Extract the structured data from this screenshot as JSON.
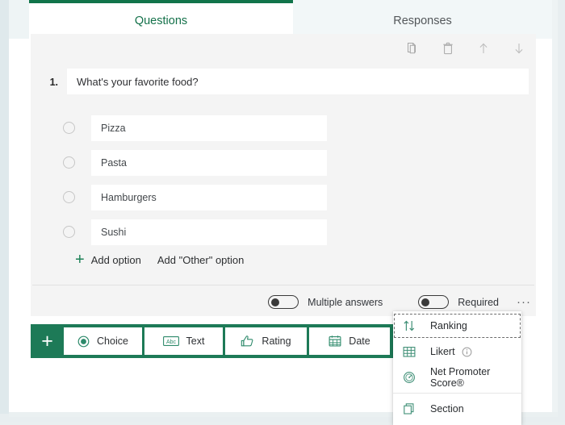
{
  "tabs": [
    {
      "label": "Questions",
      "active": true
    },
    {
      "label": "Responses",
      "active": false
    }
  ],
  "toolbar": {
    "copy_icon": "copy-icon",
    "delete_icon": "trash-icon",
    "move_up_icon": "arrow-up-icon",
    "move_down_icon": "arrow-down-icon"
  },
  "question": {
    "number": "1.",
    "title": "What's your favorite food?",
    "options": [
      {
        "label": "Pizza"
      },
      {
        "label": "Pasta"
      },
      {
        "label": "Hamburgers"
      },
      {
        "label": "Sushi"
      }
    ],
    "add_option_label": "Add option",
    "add_other_label": "Add \"Other\" option",
    "multiple_answers_label": "Multiple answers",
    "multiple_answers_state": "off",
    "required_label": "Required",
    "required_state": "off",
    "more_label": "···"
  },
  "add_question_bar": {
    "plus_label": "+",
    "types": [
      {
        "label": "Choice",
        "icon": "radio-filled-icon"
      },
      {
        "label": "Text",
        "icon": "abc-icon"
      },
      {
        "label": "Rating",
        "icon": "thumbs-up-icon"
      },
      {
        "label": "Date",
        "icon": "calendar-icon"
      }
    ]
  },
  "dropdown": {
    "items": [
      {
        "label": "Ranking",
        "icon": "sort-updown-icon",
        "focused": true,
        "info": false
      },
      {
        "label": "Likert",
        "icon": "grid-icon",
        "focused": false,
        "info": true
      },
      {
        "label": "Net Promoter Score®",
        "icon": "gauge-icon",
        "focused": false,
        "info": false
      },
      {
        "label": "Section",
        "icon": "pages-icon",
        "focused": false,
        "info": false
      }
    ]
  },
  "colors": {
    "brand_green": "#11744a",
    "bar_green": "#1d7a57",
    "icon_green": "#2e8a6b",
    "page_bg": "#e8eef0",
    "card_bg": "#f4f4f4"
  }
}
